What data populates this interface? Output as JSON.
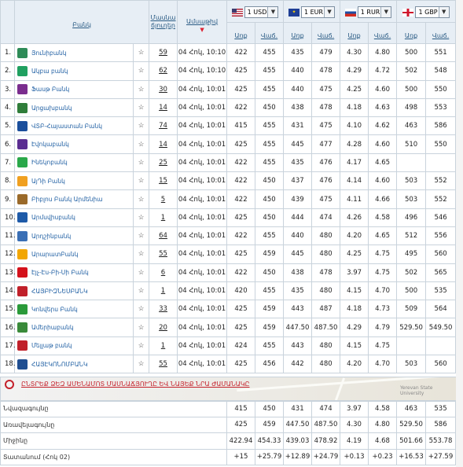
{
  "header": {
    "bank_label": "Բանկ",
    "branches_label_1": "Մասնա",
    "branches_label_2": "ճյուղեր",
    "updated_label": "Ամսաթիվ",
    "buy_label": "Առք",
    "sell_label": "Վաճ.",
    "currencies": [
      {
        "code": "1 USD",
        "flag": "us"
      },
      {
        "code": "1 EUR",
        "flag": "eu"
      },
      {
        "code": "1 RUR",
        "flag": "ru"
      },
      {
        "code": "1 GBP",
        "flag": "gb"
      }
    ]
  },
  "rows": [
    {
      "n": "1.",
      "name": "Յունիբանկ",
      "logo": "#2e8b57",
      "count": "59",
      "time": "04 Հոկ, 10:10",
      "usd_b": "422",
      "usd_s": "455",
      "eur_b": "435",
      "eur_s": "479",
      "rur_b": "4.30",
      "rur_s": "4.80",
      "gbp_b": "500",
      "gbp_s": "551"
    },
    {
      "n": "2.",
      "name": "Ակբա բանկ",
      "logo": "#20a060",
      "count": "62",
      "time": "04 Հոկ, 10:10",
      "usd_b": "425",
      "usd_s": "455",
      "eur_b": "440",
      "eur_s": "478",
      "rur_b": "4.29",
      "rur_s": "4.72",
      "gbp_b": "502",
      "gbp_s": "548"
    },
    {
      "n": "3.",
      "name": "Ֆասթ Բանկ",
      "logo": "#7a2d8e",
      "count": "30",
      "time": "04 Հոկ, 10:01",
      "usd_b": "425",
      "usd_s": "455",
      "eur_b": "440",
      "eur_s": "475",
      "rur_b": "4.25",
      "rur_s": "4.60",
      "gbp_b": "500",
      "gbp_s": "550"
    },
    {
      "n": "4.",
      "name": "Արցախբանկ",
      "logo": "#2f7d3a",
      "count": "14",
      "time": "04 Հոկ, 10:01",
      "usd_b": "422",
      "usd_s": "450",
      "eur_b": "438",
      "eur_s": "478",
      "rur_b": "4.18",
      "rur_s": "4.63",
      "gbp_b": "498",
      "gbp_s": "553"
    },
    {
      "n": "5.",
      "name": "ՎՏԲ-Հայաստան Բանկ",
      "logo": "#1b4f9c",
      "count": "74",
      "time": "04 Հոկ, 10:01",
      "usd_b": "415",
      "usd_s": "455",
      "eur_b": "431",
      "eur_s": "475",
      "rur_b": "4.10",
      "rur_s": "4.62",
      "gbp_b": "463",
      "gbp_s": "586"
    },
    {
      "n": "6.",
      "name": "Էվոկաբանկ",
      "logo": "#5a2d91",
      "count": "14",
      "time": "04 Հոկ, 10:01",
      "usd_b": "425",
      "usd_s": "455",
      "eur_b": "445",
      "eur_s": "477",
      "rur_b": "4.28",
      "rur_s": "4.60",
      "gbp_b": "510",
      "gbp_s": "550"
    },
    {
      "n": "7.",
      "name": "Ինեկոբանկ",
      "logo": "#2aa84a",
      "count": "25",
      "time": "04 Հոկ, 10:01",
      "usd_b": "422",
      "usd_s": "455",
      "eur_b": "435",
      "eur_s": "476",
      "rur_b": "4.17",
      "rur_s": "4.65",
      "gbp_b": "",
      "gbp_s": ""
    },
    {
      "n": "8.",
      "name": "ԱյԴի Բանկ",
      "logo": "#f0a020",
      "count": "15",
      "time": "04 Հոկ, 10:01",
      "usd_b": "422",
      "usd_s": "450",
      "eur_b": "437",
      "eur_s": "476",
      "rur_b": "4.14",
      "rur_s": "4.60",
      "gbp_b": "503",
      "gbp_s": "552"
    },
    {
      "n": "9.",
      "name": "Բիբլոս Բանկ Արմենիա",
      "logo": "#9a6a2a",
      "count": "5",
      "time": "04 Հոկ, 10:01",
      "usd_b": "422",
      "usd_s": "450",
      "eur_b": "439",
      "eur_s": "475",
      "rur_b": "4.11",
      "rur_s": "4.66",
      "gbp_b": "503",
      "gbp_s": "552"
    },
    {
      "n": "10.",
      "name": "Արմսվիսբանկ",
      "logo": "#1e5aa8",
      "count": "1",
      "time": "04 Հոկ, 10:01",
      "usd_b": "425",
      "usd_s": "450",
      "eur_b": "444",
      "eur_s": "474",
      "rur_b": "4.26",
      "rur_s": "4.58",
      "gbp_b": "496",
      "gbp_s": "546"
    },
    {
      "n": "11.",
      "name": "Արդշինբանկ",
      "logo": "#3a6fb5",
      "count": "64",
      "time": "04 Հոկ, 10:01",
      "usd_b": "422",
      "usd_s": "455",
      "eur_b": "440",
      "eur_s": "480",
      "rur_b": "4.20",
      "rur_s": "4.65",
      "gbp_b": "512",
      "gbp_s": "556"
    },
    {
      "n": "12.",
      "name": "ԱրարատԲանկ",
      "logo": "#f2a600",
      "count": "55",
      "time": "04 Հոկ, 10:01",
      "usd_b": "425",
      "usd_s": "459",
      "eur_b": "445",
      "eur_s": "480",
      "rur_b": "4.25",
      "rur_s": "4.75",
      "gbp_b": "495",
      "gbp_s": "560"
    },
    {
      "n": "13.",
      "name": "Էյչ-Էս-Բի-Սի Բանկ",
      "logo": "#d4111b",
      "count": "6",
      "time": "04 Հոկ, 10:01",
      "usd_b": "422",
      "usd_s": "450",
      "eur_b": "438",
      "eur_s": "478",
      "rur_b": "3.97",
      "rur_s": "4.75",
      "gbp_b": "502",
      "gbp_s": "565"
    },
    {
      "n": "14.",
      "name": "ՀԱՅԲԻԶՆԵՍԲԱՆԿ",
      "logo": "#c0202a",
      "count": "1",
      "time": "04 Հոկ, 10:01",
      "usd_b": "420",
      "usd_s": "455",
      "eur_b": "435",
      "eur_s": "480",
      "rur_b": "4.15",
      "rur_s": "4.70",
      "gbp_b": "500",
      "gbp_s": "535"
    },
    {
      "n": "15.",
      "name": "Կոնվերս Բանկ",
      "logo": "#2a9a3a",
      "count": "33",
      "time": "04 Հոկ, 10:01",
      "usd_b": "425",
      "usd_s": "459",
      "eur_b": "443",
      "eur_s": "487",
      "rur_b": "4.18",
      "rur_s": "4.73",
      "gbp_b": "509",
      "gbp_s": "564"
    },
    {
      "n": "16.",
      "name": "Ամերիաբանկ",
      "logo": "#3a8a3a",
      "count": "20",
      "time": "04 Հոկ, 10:01",
      "usd_b": "425",
      "usd_s": "459",
      "eur_b": "447.50",
      "eur_s": "487.50",
      "rur_b": "4.29",
      "rur_s": "4.79",
      "gbp_b": "529.50",
      "gbp_s": "549.50"
    },
    {
      "n": "17.",
      "name": "Մելլաթ բանկ",
      "logo": "#c0202a",
      "count": "1",
      "time": "04 Հոկ, 10:01",
      "usd_b": "424",
      "usd_s": "455",
      "eur_b": "443",
      "eur_s": "480",
      "rur_b": "4.15",
      "rur_s": "4.75",
      "gbp_b": "",
      "gbp_s": ""
    },
    {
      "n": "18.",
      "name": "ՀԱՅԷԿՈՆՈՄԲԱՆԿ",
      "logo": "#1f4e91",
      "count": "55",
      "time": "04 Հոկ, 10:01",
      "usd_b": "425",
      "usd_s": "456",
      "eur_b": "442",
      "eur_s": "480",
      "rur_b": "4.20",
      "rur_s": "4.70",
      "gbp_b": "503",
      "gbp_s": "560"
    }
  ],
  "map": {
    "link": "ԸՆՏՐԵՔ ՁԵԶ ԱՄԵՆԱՄՈՏ ՄԱՍՆԱՃՅՈՒՂԸ ԵՎ ՆԱՅԵՔ ՆՐԱ ԺԱՄԱՆԱԿԸ",
    "place": "Yerevan State\nUniversity"
  },
  "summary": [
    {
      "label": "Նվազագույնը",
      "vals": [
        "415",
        "450",
        "431",
        "474",
        "3.97",
        "4.58",
        "463",
        "535"
      ]
    },
    {
      "label": "Առավելագույնը",
      "vals": [
        "425",
        "459",
        "447.50",
        "487.50",
        "4.30",
        "4.80",
        "529.50",
        "586"
      ]
    },
    {
      "label": "Միջինը",
      "vals": [
        "422.94",
        "454.33",
        "439.03",
        "478.92",
        "4.19",
        "4.68",
        "501.66",
        "553.78"
      ]
    },
    {
      "label": "Տատանում (Հոկ 02)",
      "vals": [
        "+15",
        "+25.79",
        "+12.89",
        "+24.79",
        "+0.13",
        "+0.23",
        "+16.53",
        "+27.59"
      ]
    }
  ]
}
